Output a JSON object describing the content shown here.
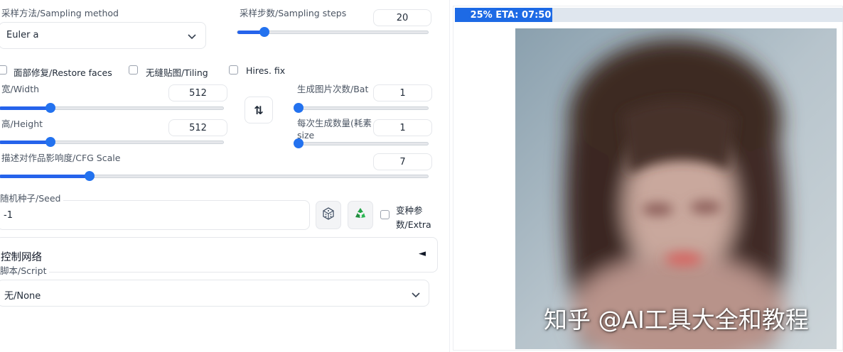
{
  "sampling": {
    "method_label": "采样方法/Sampling method",
    "method_value": "Euler a",
    "steps_label": "采样步数/Sampling steps",
    "steps_value": "20",
    "steps_fraction": 0.14
  },
  "checkboxes": {
    "restore_faces": "面部修复/Restore faces",
    "tiling": "无缝贴图/Tiling",
    "hires_fix": "Hires. fix"
  },
  "width": {
    "label": "宽/Width",
    "value": "512",
    "fraction": 0.23
  },
  "height": {
    "label": "高/Height",
    "value": "512",
    "fraction": 0.23
  },
  "swap_icon": "⇅",
  "batch_count": {
    "label": "生成图片次数/Bat",
    "value": "1",
    "fraction": 0.0
  },
  "batch_size": {
    "label_line1": "每次生成数量(耗素",
    "label_line2": "size",
    "value": "1",
    "fraction": 0.0
  },
  "cfg": {
    "label": "描述对作品影响度/CFG Scale",
    "value": "7",
    "fraction": 0.21
  },
  "seed": {
    "label": "随机种子/Seed",
    "value": "-1",
    "dice_icon": "dice-icon",
    "recycle_icon": "recycle-icon",
    "extra_line1": "变种参",
    "extra_line2": "数/Extra"
  },
  "controlnet": {
    "label": "控制网络",
    "toggle": "◄"
  },
  "script": {
    "label": "脚本/Script",
    "value": "无/None"
  },
  "progress": {
    "text": "25% ETA: 07:50",
    "fraction": 0.25
  },
  "watermark": "知乎 @AI工具大全和教程",
  "colors": {
    "accent": "#2563eb",
    "progress_bar": "#1d6ae5",
    "track": "#e5e7eb"
  }
}
